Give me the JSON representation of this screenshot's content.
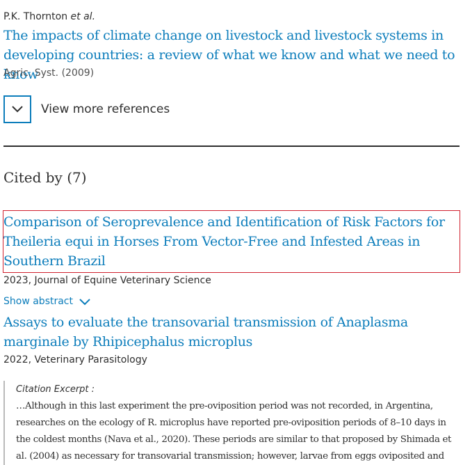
{
  "reference": {
    "authors": "P.K. Thornton",
    "et_al": "et al.",
    "title": "The impacts of climate change on livestock and livestock systems in developing countries: a review of what we know and what we need to know",
    "source": "Agric. Syst. (2009)"
  },
  "view_more": {
    "icon": "chevron-down-icon",
    "label": "View more references"
  },
  "cited_by": {
    "heading": "Cited by",
    "count": "(7)"
  },
  "citations": [
    {
      "title": "Comparison of Seroprevalence and Identification of Risk Factors for Theileria equi in Horses From Vector-Free and Infested Areas in Southern Brazil",
      "meta": "2023, Journal of Equine Veterinary Science",
      "show_abstract": "Show abstract"
    },
    {
      "title": "Assays to evaluate the transovarial transmission of Anaplasma marginale by Rhipicephalus microplus",
      "meta": "2022, Veterinary Parasitology",
      "excerpt_label": "Citation Excerpt :",
      "excerpt": "…Although in this last experiment the pre-oviposition period was not recorded, in Argentina, researches on the ecology of R. microplus have reported pre-oviposition periods of 8–10 days in the coldest months (Nava et al., 2020). These periods are similar to that proposed by Shimada et al. (2004) as necessary for transovarial transmission; however, larvae from eggs oviposited and"
    }
  ],
  "colors": {
    "link": "#0c7dbb",
    "text": "#2e2e2e",
    "highlight_border": "#d0202e"
  }
}
